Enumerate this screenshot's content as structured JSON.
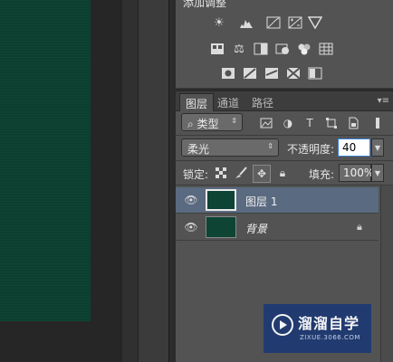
{
  "adjustments": {
    "title": "添加调整",
    "row1": [
      "brightness-contrast-icon",
      "levels-icon",
      "curves-icon",
      "exposure-icon",
      "gradient-triangle-icon"
    ],
    "row2": [
      "vibrance-icon",
      "color-balance-icon",
      "black-white-icon",
      "photo-filter-icon",
      "channel-mixer-icon",
      "color-lookup-icon"
    ],
    "row3": [
      "invert-icon",
      "posterize-icon",
      "threshold-icon",
      "selective-color-icon",
      "gradient-map-icon"
    ]
  },
  "layers_panel": {
    "tabs": [
      "图层",
      "通道",
      "路径"
    ],
    "active_tab": "图层",
    "filter_kind": "类型",
    "blend_mode": "柔光",
    "opacity_label": "不透明度:",
    "opacity_value": "40",
    "lock_label": "锁定:",
    "fill_label": "填充:",
    "fill_value": "100%",
    "layers": [
      {
        "name": "图层 1",
        "selected": true,
        "locked": false,
        "italic": false
      },
      {
        "name": "背景",
        "selected": false,
        "locked": true,
        "italic": true
      }
    ]
  },
  "watermark": {
    "title": "溜溜自学",
    "subtitle": "ZIXUE.3066.COM"
  },
  "colors": {
    "canvas": "#0b3f2f",
    "panel": "#535353",
    "selection": "#5a6a80",
    "watermark_bg": "#1f3a72"
  }
}
